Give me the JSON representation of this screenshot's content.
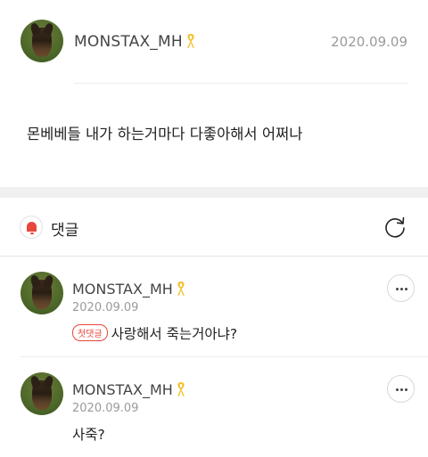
{
  "post": {
    "author": "MONSTAX_MH",
    "date": "2020.09.09",
    "body": "몬베베들 내가 하는거마다 다좋아해서 어쩌나"
  },
  "comments_section": {
    "title": "댓글"
  },
  "comments": [
    {
      "author": "MONSTAX_MH",
      "date": "2020.09.09",
      "badge": "첫댓글",
      "text": "사랑해서 죽는거아냐?"
    },
    {
      "author": "MONSTAX_MH",
      "date": "2020.09.09",
      "text": "사죽?"
    }
  ],
  "colors": {
    "accent": "#e8473c",
    "ribbon": "#f2c230",
    "muted": "#9a9a9a"
  },
  "icons": [
    "ribbon-icon",
    "bell-icon",
    "refresh-icon",
    "more-icon",
    "avatar"
  ]
}
